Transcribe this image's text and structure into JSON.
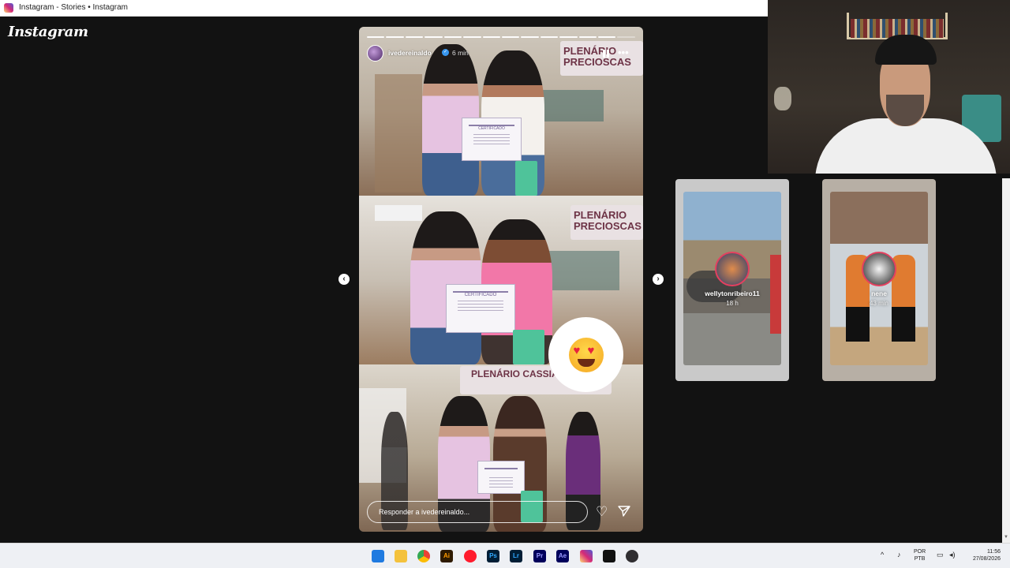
{
  "browser": {
    "title": "Instagram - Stories • Instagram"
  },
  "app": {
    "logo": "Instagram"
  },
  "story": {
    "username": "ivedereinaldo",
    "time": "6 min",
    "more": "•••",
    "reply_placeholder": "Responder a ivedereinaldo...",
    "wall_text_1": "PLENÁRIO PRECIOSCAS",
    "wall_text_2": "PLENÁRIO PRECIOSCAS",
    "wall_text_3": "PLENÁRIO CASSIANO PINTO",
    "cert_title": "CERTIFICADO",
    "progress_segments_total": 14,
    "progress_segments_done": 13
  },
  "previews": [
    {
      "username": "wellytonribeiro11",
      "time": "18 h"
    },
    {
      "username": "nene",
      "time": "43 min"
    }
  ],
  "taskbar": {
    "lang_top": "POR",
    "lang_bottom": "PTB",
    "time": "11:56",
    "date": "27/08/2026"
  },
  "colors": {
    "background": "#121212",
    "accent_ring": "#e4405f",
    "verified": "#3897f0"
  },
  "icons": [
    "windows-start-icon",
    "file-explorer-icon",
    "chrome-icon",
    "illustrator-icon",
    "opera-icon",
    "photoshop-icon",
    "lightroom-icon",
    "premiere-icon",
    "after-effects-icon",
    "instagram-icon",
    "capcut-icon",
    "obs-icon"
  ]
}
